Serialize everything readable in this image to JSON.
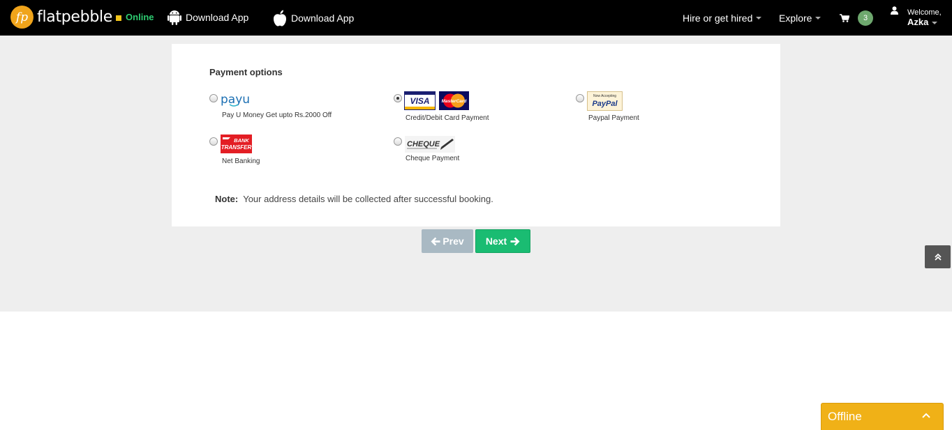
{
  "header": {
    "logo_mark": "fp",
    "logo_text": "flatpebble",
    "status_text": "Online",
    "download_android_label": "Download App",
    "download_ios_label": "Download App",
    "hire_label": "Hire or get hired",
    "explore_label": "Explore",
    "cart_count": "3",
    "welcome_label": "Welcome,",
    "user_name": "Azka"
  },
  "payment": {
    "title": "Payment options",
    "options": [
      {
        "id": "payu",
        "logo_text": "payu",
        "label": "Pay U Money Get upto Rs.2000 Off",
        "selected": false
      },
      {
        "id": "card",
        "logo_text": "VISA",
        "logo_text_2": "MasterCard",
        "label": "Credit/Debit Card Payment",
        "selected": true
      },
      {
        "id": "paypal",
        "logo_text_small": "Now Accepting",
        "logo_text": "PayPal",
        "label": "Paypal Payment",
        "selected": false
      },
      {
        "id": "netbanking",
        "logo_text": "BANK",
        "logo_text_2": "TRANSFER",
        "label": "Net Banking",
        "selected": false
      },
      {
        "id": "cheque",
        "logo_text": "CHEQUE",
        "label": "Cheque Payment",
        "selected": false
      }
    ],
    "note_label": "Note:",
    "note_text": "Your address details will be collected after successful booking."
  },
  "nav_buttons": {
    "prev_label": "Prev",
    "next_label": "Next"
  },
  "chat": {
    "status_label": "Offline"
  },
  "colors": {
    "navbar": "#000000",
    "brand_orange": "#f0a41b",
    "online_green": "#2ecc71",
    "next_green": "#1abc72",
    "prev_grey": "#a9b9c3",
    "offline_yellow": "#f0b117"
  }
}
